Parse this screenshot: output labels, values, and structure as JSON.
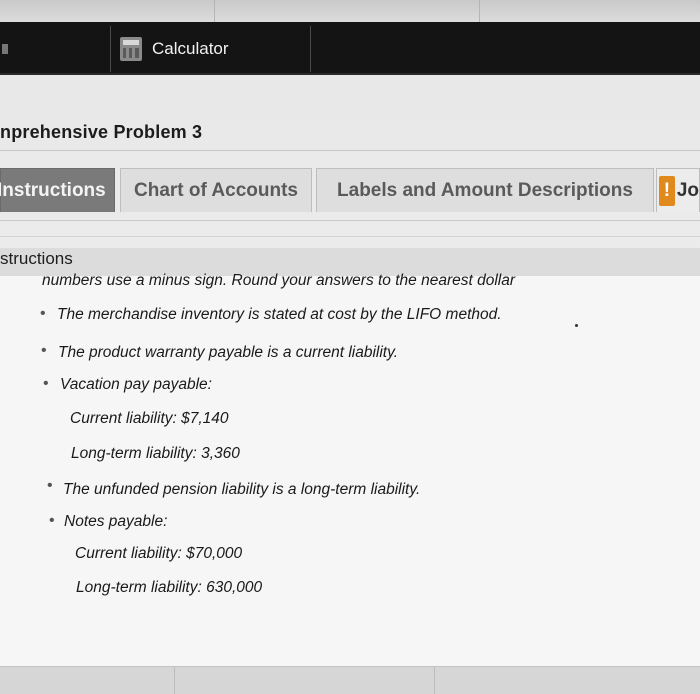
{
  "toolbar": {
    "calculator_label": "Calculator"
  },
  "page": {
    "title": "nprehensive Problem 3"
  },
  "tabs": [
    {
      "label": "Instructions"
    },
    {
      "label": "Chart of Accounts"
    },
    {
      "label": "Labels and Amount Descriptions"
    },
    {
      "label": "Jo",
      "badge": "!"
    }
  ],
  "instructions": {
    "heading": "structions",
    "intro": "numbers use a minus sign. Round your answers to the nearest dollar",
    "items": [
      {
        "text": "The merchandise inventory is stated at cost by the LIFO method."
      },
      {
        "text": "The product warranty payable is a current liability."
      },
      {
        "text": "Vacation pay payable:",
        "sub": [
          "Current liability: $7,140",
          "Long-term liability: 3,360"
        ]
      },
      {
        "text": "The unfunded pension liability is a long-term liability."
      },
      {
        "text": "Notes payable:",
        "sub": [
          "Current liability: $70,000",
          "Long-term liability: 630,000"
        ]
      }
    ]
  },
  "colors": {
    "toolbar": "#141414",
    "active_tab": "#7a7a7a",
    "warn_badge": "#e08a1e"
  }
}
